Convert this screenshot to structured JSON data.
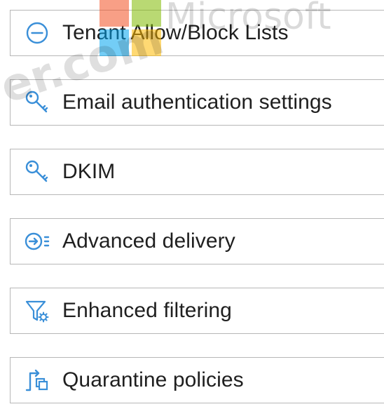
{
  "menu": {
    "items": [
      {
        "label": "Tenant Allow/Block Lists",
        "icon": "minus-circle-icon"
      },
      {
        "label": "Email authentication settings",
        "icon": "key-icon"
      },
      {
        "label": "DKIM",
        "icon": "key-icon"
      },
      {
        "label": "Advanced delivery",
        "icon": "arrow-list-icon"
      },
      {
        "label": "Enhanced filtering",
        "icon": "filter-gear-icon"
      },
      {
        "label": "Quarantine policies",
        "icon": "flow-copy-icon"
      }
    ]
  },
  "watermark": {
    "brand_text": "Microsoft",
    "domain_fragment": "er.com"
  },
  "colors": {
    "icon_blue": "#3a8fd8",
    "label_text": "#1f1f1f",
    "border": "#b7b7b7"
  }
}
